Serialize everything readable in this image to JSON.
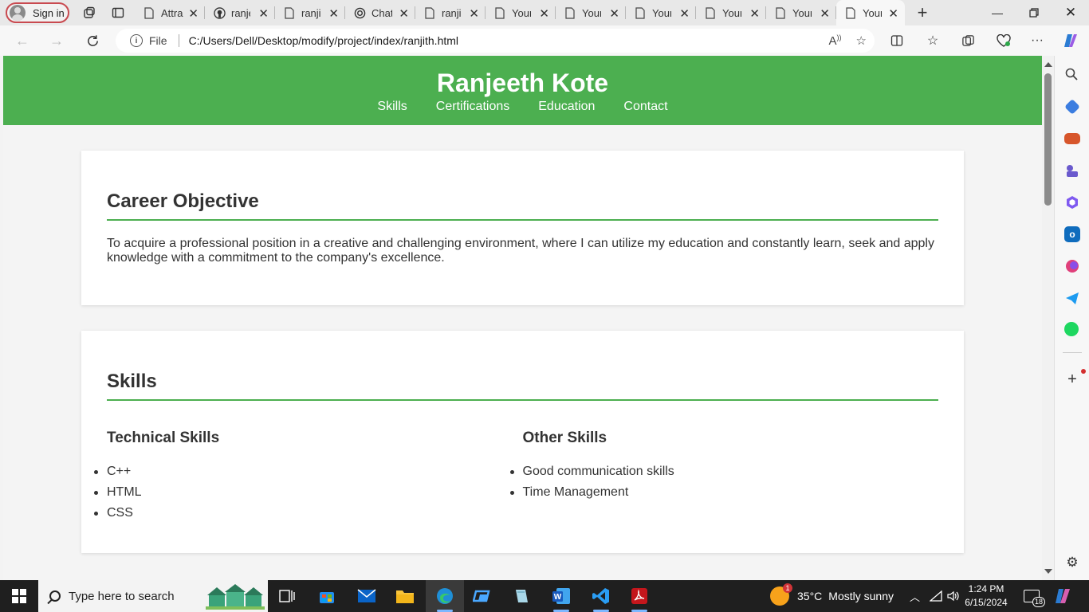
{
  "browser": {
    "profile_label": "Sign in",
    "tabs": [
      {
        "title": "Attra",
        "icon": "page-icon"
      },
      {
        "title": "ranje",
        "icon": "github-icon"
      },
      {
        "title": "ranji",
        "icon": "page-icon"
      },
      {
        "title": "Chat",
        "icon": "chatgpt-icon"
      },
      {
        "title": "ranji",
        "icon": "page-icon"
      },
      {
        "title": "Your",
        "icon": "page-icon"
      },
      {
        "title": "Your",
        "icon": "page-icon"
      },
      {
        "title": "Your",
        "icon": "page-icon"
      },
      {
        "title": "Your",
        "icon": "page-icon"
      },
      {
        "title": "Your",
        "icon": "page-icon"
      },
      {
        "title": "Your",
        "icon": "page-icon",
        "active": true
      }
    ],
    "address": {
      "scheme_label": "File",
      "url": "C:/Users/Dell/Desktop/modify/project/index/ranjith.html"
    }
  },
  "page": {
    "header": {
      "name": "Ranjeeth Kote",
      "nav": [
        "Skills",
        "Certifications",
        "Education",
        "Contact"
      ]
    },
    "career": {
      "heading": "Career Objective",
      "text": "To acquire a professional position in a creative and challenging environment, where I can utilize my education and constantly learn, seek and apply knowledge with a commitment to the company's excellence."
    },
    "skills": {
      "heading": "Skills",
      "technical": {
        "heading": "Technical Skills",
        "items": [
          "C++",
          "HTML",
          "CSS"
        ]
      },
      "other": {
        "heading": "Other Skills",
        "items": [
          "Good communication skills",
          "Time Management"
        ]
      }
    }
  },
  "taskbar": {
    "search_placeholder": "Type here to search",
    "weather": {
      "temp": "35°C",
      "condition": "Mostly sunny",
      "badge": "1"
    },
    "time": "1:24 PM",
    "date": "6/15/2024",
    "notification_count": "18"
  },
  "colors": {
    "accent_green": "#4caf50",
    "text_dark": "#333333"
  }
}
